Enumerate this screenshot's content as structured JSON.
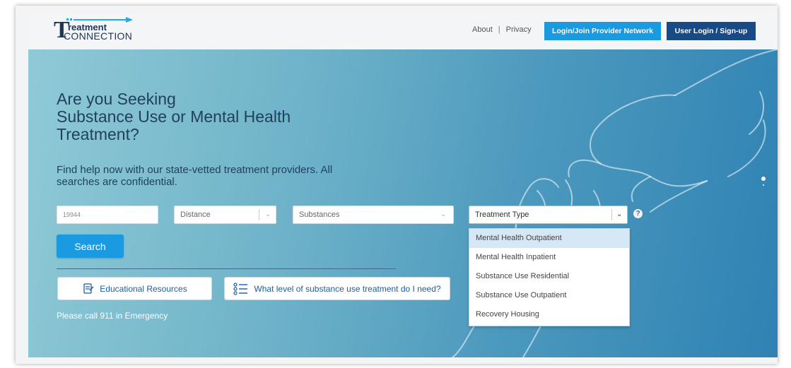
{
  "brand": {
    "logo_letter": "T",
    "logo_line1": "reatment",
    "logo_line2": "CONNECTION"
  },
  "nav": {
    "about": "About",
    "separator": "|",
    "privacy": "Privacy",
    "provider_button": "Login/Join Provider Network",
    "user_button": "User Login / Sign-up"
  },
  "hero": {
    "heading_lines": [
      "Are you Seeking",
      "Substance Use or Mental Health",
      "Treatment?"
    ],
    "subtext_lines": [
      "Find help now with our state-vetted treatment providers. All",
      "searches are confidential."
    ],
    "emergency": "Please call 911 in Emergency"
  },
  "search": {
    "zip_value": "19944",
    "distance_label": "Distance",
    "substances_label": "Substances",
    "treatment_type_label": "Treatment Type",
    "help_glyph": "?",
    "button": "Search",
    "treatment_options": [
      "Mental Health Outpatient",
      "Mental Health Inpatient",
      "Substance Use Residential",
      "Substance Use Outpatient",
      "Recovery Housing"
    ]
  },
  "resources": {
    "educational": "Educational Resources",
    "level_question": "What level of substance use treatment do I need?"
  },
  "icons": {
    "logo_arrow": "arrow-right-icon",
    "dropdown": "chevron-down-icon",
    "help": "question-circle-icon",
    "educational": "document-icon",
    "level": "checklist-icon",
    "carousel": "carousel-dot-icon"
  },
  "colors": {
    "primary_blue": "#1a9ae1",
    "navy": "#184b86",
    "heading_text": "#21405e",
    "link_text": "#1c5d9e"
  }
}
